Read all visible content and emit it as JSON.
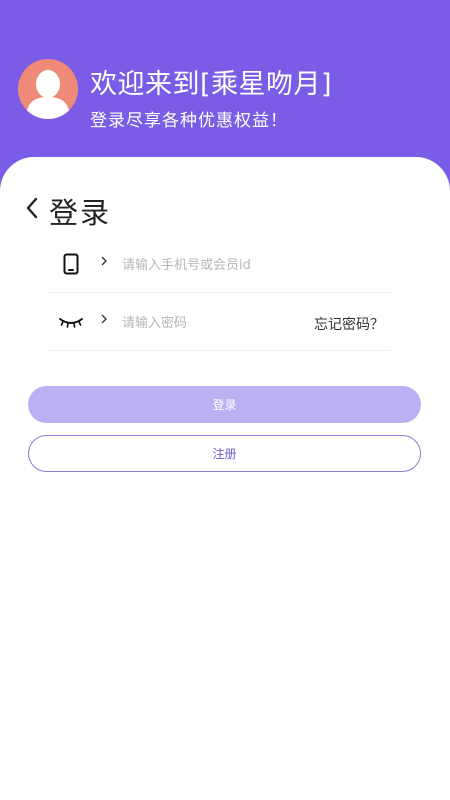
{
  "header": {
    "welcome": "欢迎来到[乘星吻月]",
    "subtitle": "登录尽享各种优惠权益！"
  },
  "page": {
    "title": "登录"
  },
  "form": {
    "phone_placeholder": "请输入手机号或会员id",
    "password_placeholder": "请输入密码",
    "forgot_label": "忘记密码？"
  },
  "buttons": {
    "login": "登录",
    "register": "注册"
  },
  "colors": {
    "header_bg": "#7b5ce6",
    "avatar_bg": "#f08a78",
    "login_button_bg": "#bcb0f2",
    "register_border": "#8c7ad6"
  },
  "icons": {
    "back": "chevron-left-icon",
    "phone": "phone-icon",
    "field_chevron": "chevron-right-icon",
    "password_toggle": "eye-closed-icon"
  }
}
